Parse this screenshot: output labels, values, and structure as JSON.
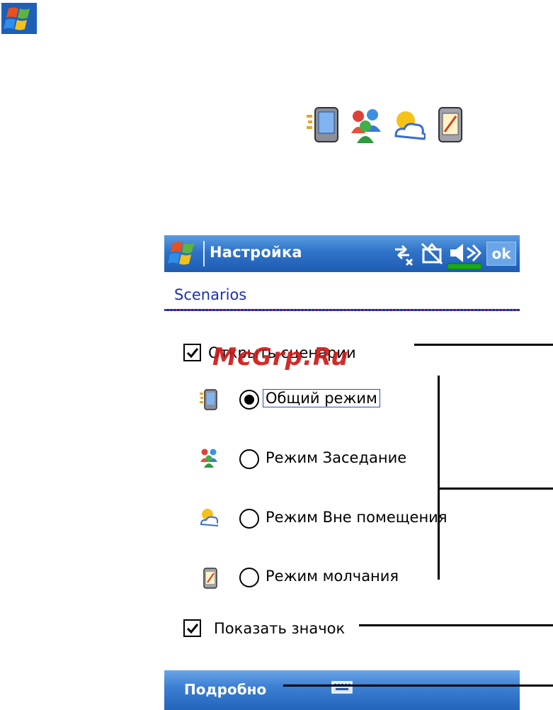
{
  "header_icons": [
    "windows-flag-icon"
  ],
  "scenario_icons": [
    "general-mode-device-icon",
    "meeting-people-icon",
    "outdoor-sun-icon",
    "silent-device-icon"
  ],
  "device": {
    "titlebar": {
      "start_icon": "windows-flag-icon",
      "title": "Настройка",
      "status_icons": [
        "connectivity-icon",
        "sync-off-icon",
        "volume-icon",
        "battery-icon"
      ],
      "ok_label": "ok"
    },
    "subheader": "Scenarios",
    "open_scenarios": {
      "label": "Открыть сценарии",
      "checked": true
    },
    "scenarios": [
      {
        "icon": "general-mode-device-icon",
        "label": "Общий режим",
        "selected": true
      },
      {
        "icon": "meeting-people-icon",
        "label": "Режим Заседание",
        "selected": false
      },
      {
        "icon": "outdoor-sun-icon",
        "label": "Режим Вне помещения",
        "selected": false
      },
      {
        "icon": "silent-device-icon",
        "label": "Режим молчания",
        "selected": false
      }
    ],
    "show_icon": {
      "label": "Показать значок",
      "checked": true
    },
    "menubar": {
      "left_softkey": "Подробно",
      "keyboard_icon": "keyboard-icon"
    }
  },
  "watermark": "McGrp.Ru",
  "colors": {
    "titlebar": "#2f73c9",
    "subheader_text": "#1b2fb5",
    "watermark": "#d01818"
  }
}
